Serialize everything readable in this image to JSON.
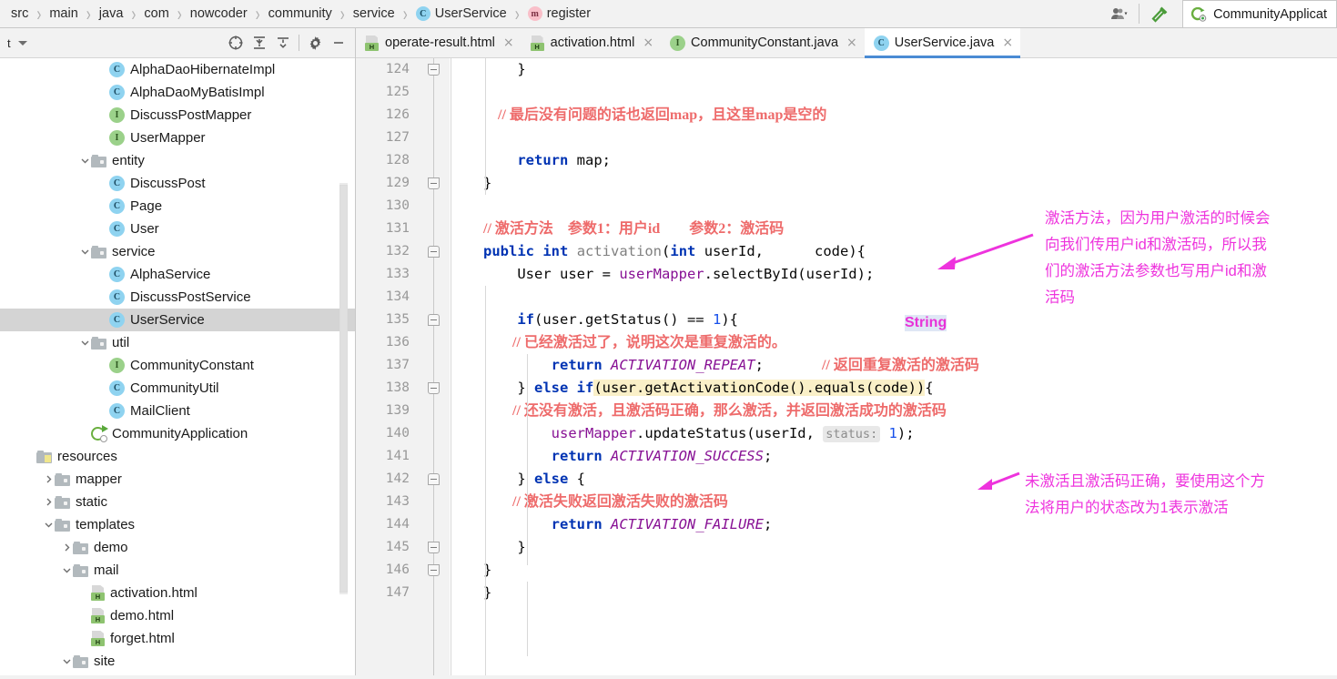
{
  "navbar": {
    "breadcrumbs": [
      {
        "label": "src",
        "badge": ""
      },
      {
        "label": "main",
        "badge": ""
      },
      {
        "label": "java",
        "badge": ""
      },
      {
        "label": "com",
        "badge": ""
      },
      {
        "label": "nowcoder",
        "badge": ""
      },
      {
        "label": "community",
        "badge": ""
      },
      {
        "label": "service",
        "badge": ""
      },
      {
        "label": "UserService",
        "badge": "C"
      },
      {
        "label": "register",
        "badge": "m"
      }
    ],
    "separator": "›",
    "user_icon": "user-settings-icon",
    "dropdown_icon": "chevron-down-icon",
    "build_icon": "hammer-icon",
    "run_config": "CommunityApplicat"
  },
  "tool_window": {
    "title": "t",
    "dropdown_icon": "chevron-down-icon",
    "icons": [
      "locate-icon",
      "expand-all-icon",
      "collapse-all-icon",
      "gear-icon",
      "minimize-icon"
    ]
  },
  "tree": [
    {
      "label": "AlphaDaoHibernateImpl",
      "indent": 5,
      "icon": "class",
      "arrow": "",
      "selected": false
    },
    {
      "label": "AlphaDaoMyBatisImpl",
      "indent": 5,
      "icon": "class",
      "arrow": "",
      "selected": false
    },
    {
      "label": "DiscussPostMapper",
      "indent": 5,
      "icon": "interface",
      "arrow": "",
      "selected": false
    },
    {
      "label": "UserMapper",
      "indent": 5,
      "icon": "interface",
      "arrow": "",
      "selected": false
    },
    {
      "label": "entity",
      "indent": 4,
      "icon": "folder",
      "arrow": "expanded",
      "selected": false
    },
    {
      "label": "DiscussPost",
      "indent": 5,
      "icon": "class",
      "arrow": "",
      "selected": false
    },
    {
      "label": "Page",
      "indent": 5,
      "icon": "class",
      "arrow": "",
      "selected": false
    },
    {
      "label": "User",
      "indent": 5,
      "icon": "class",
      "arrow": "",
      "selected": false
    },
    {
      "label": "service",
      "indent": 4,
      "icon": "folder",
      "arrow": "expanded",
      "selected": false
    },
    {
      "label": "AlphaService",
      "indent": 5,
      "icon": "class",
      "arrow": "",
      "selected": false
    },
    {
      "label": "DiscussPostService",
      "indent": 5,
      "icon": "class",
      "arrow": "",
      "selected": false
    },
    {
      "label": "UserService",
      "indent": 5,
      "icon": "class",
      "arrow": "",
      "selected": true
    },
    {
      "label": "util",
      "indent": 4,
      "icon": "folder",
      "arrow": "expanded",
      "selected": false
    },
    {
      "label": "CommunityConstant",
      "indent": 5,
      "icon": "interface",
      "arrow": "",
      "selected": false
    },
    {
      "label": "CommunityUtil",
      "indent": 5,
      "icon": "class",
      "arrow": "",
      "selected": false
    },
    {
      "label": "MailClient",
      "indent": 5,
      "icon": "class",
      "arrow": "",
      "selected": false
    },
    {
      "label": "CommunityApplication",
      "indent": 4,
      "icon": "spring",
      "arrow": "",
      "selected": false
    },
    {
      "label": "resources",
      "indent": 1,
      "icon": "resources",
      "arrow": "",
      "selected": false
    },
    {
      "label": "mapper",
      "indent": 2,
      "icon": "folder",
      "arrow": "collapsed",
      "selected": false
    },
    {
      "label": "static",
      "indent": 2,
      "icon": "folder",
      "arrow": "collapsed",
      "selected": false
    },
    {
      "label": "templates",
      "indent": 2,
      "icon": "folder",
      "arrow": "expanded",
      "selected": false
    },
    {
      "label": "demo",
      "indent": 3,
      "icon": "folder",
      "arrow": "collapsed",
      "selected": false
    },
    {
      "label": "mail",
      "indent": 3,
      "icon": "folder",
      "arrow": "expanded",
      "selected": false
    },
    {
      "label": "activation.html",
      "indent": 4,
      "icon": "html",
      "arrow": "",
      "selected": false
    },
    {
      "label": "demo.html",
      "indent": 4,
      "icon": "html",
      "arrow": "",
      "selected": false
    },
    {
      "label": "forget.html",
      "indent": 4,
      "icon": "html",
      "arrow": "",
      "selected": false
    },
    {
      "label": "site",
      "indent": 3,
      "icon": "folder",
      "arrow": "expanded",
      "selected": false
    }
  ],
  "tabs": [
    {
      "label": "operate-result.html",
      "icon": "html",
      "active": false,
      "close": "×"
    },
    {
      "label": "activation.html",
      "icon": "html",
      "active": false,
      "close": "×"
    },
    {
      "label": "CommunityConstant.java",
      "icon": "interface",
      "active": false,
      "close": "×"
    },
    {
      "label": "UserService.java",
      "icon": "class",
      "active": true,
      "close": "×"
    }
  ],
  "editor": {
    "first_line": 124,
    "line_numbers": [
      124,
      125,
      126,
      127,
      128,
      129,
      130,
      131,
      132,
      133,
      134,
      135,
      136,
      137,
      138,
      139,
      140,
      141,
      142,
      143,
      144,
      145,
      146,
      147
    ],
    "string_overlay": "String",
    "param_hint": "status:",
    "lines": {
      "124": "        }",
      "125": "",
      "126": "        // 最后没有问题的话也返回map，且这里map是空的",
      "127": "",
      "128": "        return map;",
      "129": "    }",
      "130": "",
      "131": "    // 激活方法    参数1：用户id        参数2：激活码",
      "132": "    public int activation(int userId,String code){",
      "133": "        User user = userMapper.selectById(userId);",
      "134": "",
      "135": "        if(user.getStatus() == 1){",
      "136": "            // 已经激活过了，说明这次是重复激活的。",
      "137": "            return ACTIVATION_REPEAT;        // 返回重复激活的激活码",
      "138": "        } else if(user.getActivationCode().equals(code)){",
      "139": "            // 还没有激活，且激活码正确，那么激活，并返回激活成功的激活码",
      "140": "            userMapper.updateStatus(userId,  status: 1);",
      "141": "            return ACTIVATION_SUCCESS;",
      "142": "        } else {",
      "143": "            // 激活失败返回激活失败的激活码",
      "144": "            return ACTIVATION_FAILURE;",
      "145": "        }",
      "146": "    }",
      "147": "}"
    }
  },
  "annotations": [
    {
      "id": "annotation-activation-method",
      "text": "激活方法，因为用户激活的时候会\n向我们传用户id和激活码，所以我\n们的激活方法参数也写用户id和激\n活码",
      "color": "#ee33dd"
    },
    {
      "id": "annotation-update-status",
      "text": "未激活且激活码正确，要使用这个方\n法将用户的状态改为1表示激活",
      "color": "#ee33dd"
    }
  ],
  "colors": {
    "annotation": "#ee33dd",
    "comment": "#ee6b6b",
    "keyword": "#0033b3",
    "field": "#871094",
    "number": "#1750eb",
    "tab_active_underline": "#4a8bd4",
    "selection": "#d4d4d4",
    "condition_highlight": "#faf0c8"
  }
}
